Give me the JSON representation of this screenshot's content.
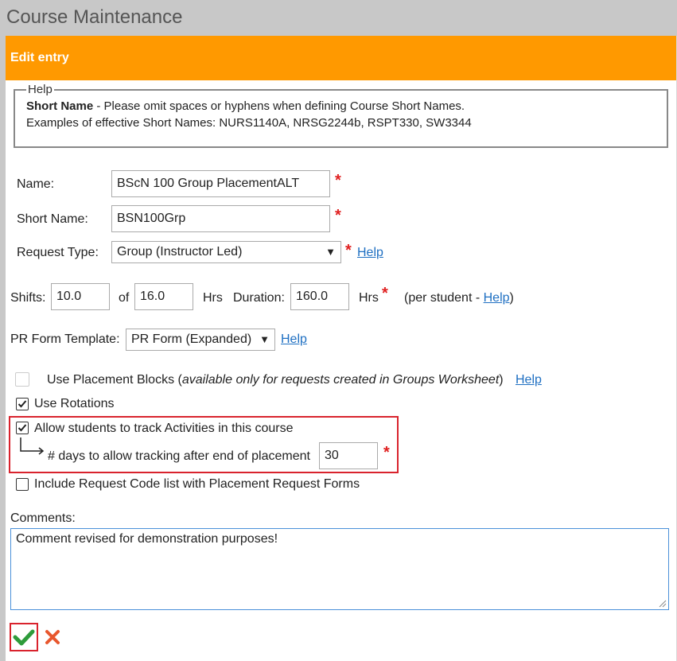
{
  "page": {
    "title": "Course Maintenance"
  },
  "panel": {
    "header": "Edit entry"
  },
  "help": {
    "legend": "Help",
    "short_name_label": "Short Name",
    "short_name_text": " - Please omit spaces or hyphens when defining Course Short Names.",
    "examples": "Examples of effective Short Names: NURS1140A,  NRSG2244b,  RSPT330,  SW3344"
  },
  "form": {
    "name_label": "Name:",
    "name_value": "BScN 100 Group PlacementALT",
    "short_name_label": "Short Name:",
    "short_name_value": "BSN100Grp",
    "request_type_label": "Request Type:",
    "request_type_value": "Group (Instructor Led)",
    "help_link": "Help",
    "shifts_label": "Shifts:",
    "shifts_value": "10.0",
    "of_label": "of",
    "of_value": "16.0",
    "hrs_label": "Hrs",
    "duration_label": "Duration:",
    "duration_value": "160.0",
    "hrs_label2": "Hrs",
    "per_student_prefix": "(per student - ",
    "per_student_suffix": ")",
    "pr_form_label": "PR Form Template:",
    "pr_form_value": "PR Form (Expanded)",
    "required_mark": "*"
  },
  "options": {
    "use_placement_blocks": "Use Placement Blocks (",
    "use_placement_blocks_note": "available only for requests created in Groups Worksheet",
    "use_placement_blocks_close": ")",
    "use_rotations": "Use Rotations",
    "allow_tracking": "Allow students to track Activities in this course",
    "days_tracking_label": "# days to allow tracking after end of placement",
    "days_tracking_value": "30",
    "include_request_code": "Include Request Code list with Placement Request Forms",
    "use_placement_blocks_checked": false,
    "use_rotations_checked": true,
    "allow_tracking_checked": true,
    "include_request_code_checked": false
  },
  "comments": {
    "label": "Comments:",
    "value": "Comment revised for demonstration purposes!"
  },
  "colors": {
    "header": "#ff9900",
    "required": "#e02020",
    "highlight": "#d9232d",
    "save": "#2e9b3a",
    "cancel": "#e8572e",
    "link": "#1e6fc2"
  }
}
